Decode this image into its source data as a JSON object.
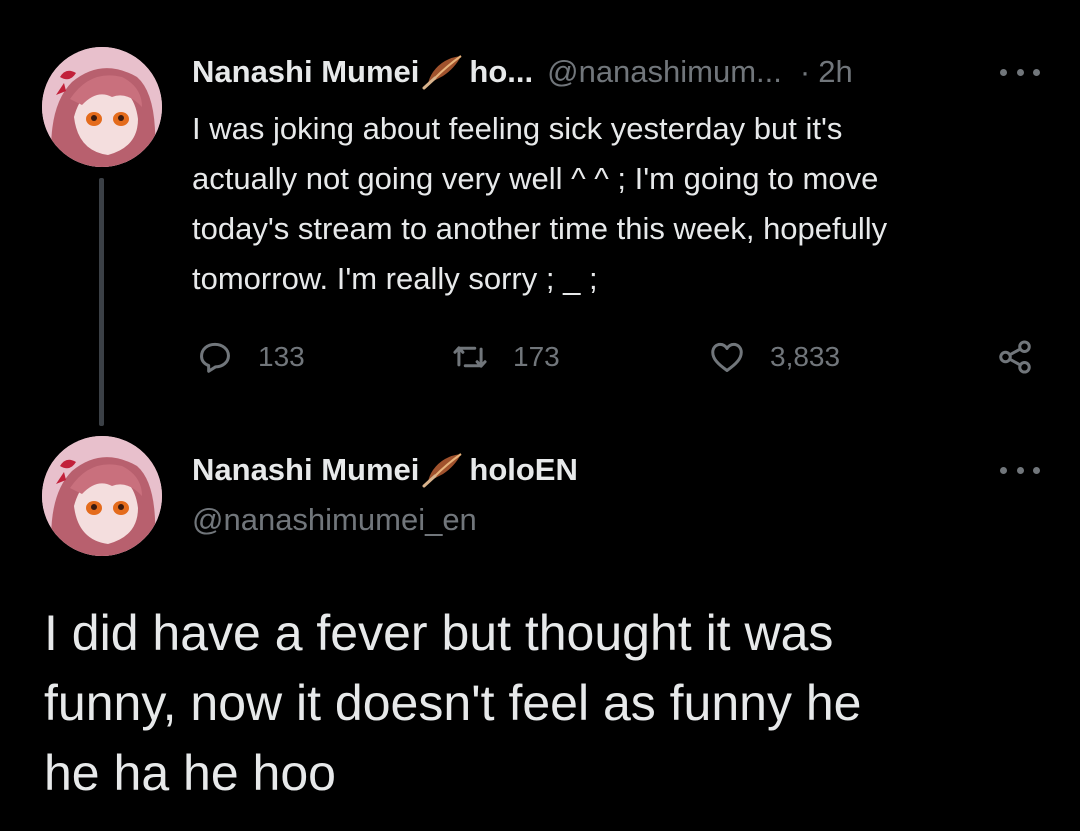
{
  "reply_tweet": {
    "display_name": "Nanashi Mumei",
    "affiliation_truncated": "ho...",
    "handle_truncated": "@nanashimum...",
    "time_separator": "·",
    "time": "2h",
    "text_lines": [
      "I was joking about feeling sick yesterday but it's",
      "actually not going very well ^ ^ ; I'm going to move",
      "today's stream to another time this week, hopefully",
      "tomorrow. I'm really sorry ; _ ;"
    ],
    "actions": {
      "replies": "133",
      "retweets": "173",
      "likes": "3,833"
    },
    "icons": [
      "reply-icon",
      "retweet-icon",
      "like-icon",
      "share-icon",
      "feather-icon",
      "more-icon"
    ]
  },
  "main_tweet": {
    "display_name": "Nanashi Mumei",
    "affiliation": "holoEN",
    "handle": "@nanashimumei_en",
    "text_lines": [
      "I did have a fever but thought it was",
      "funny, now it doesn't feel as funny he",
      "he ha he hoo"
    ]
  },
  "colors": {
    "background": "#000000",
    "text_primary": "#e7e9ea",
    "text_secondary": "#71767b",
    "thread_line": "#3b4046",
    "feather_brown": "#a0522d"
  }
}
